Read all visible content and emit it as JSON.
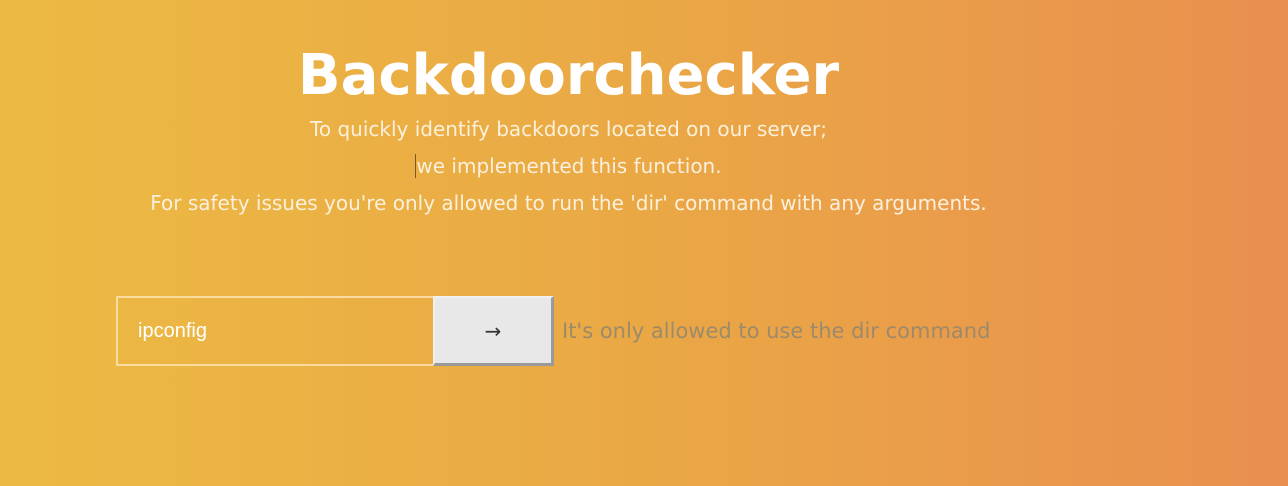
{
  "header": {
    "title": "Backdoorchecker"
  },
  "description": {
    "line1": "To quickly identify backdoors located on our server;",
    "line2": "we implemented this function.",
    "line3": "For safety issues you're only allowed to run the 'dir' command with any arguments."
  },
  "form": {
    "command_value": "ipconfig",
    "submit_label": "→",
    "submit_icon": "arrow-right-icon",
    "hint": "It's only allowed to use the dir command"
  },
  "colors": {
    "gradient_start": "#ecba43",
    "gradient_end": "#e98f4f",
    "title": "#ffffff",
    "hint": "#9c8a6a"
  }
}
